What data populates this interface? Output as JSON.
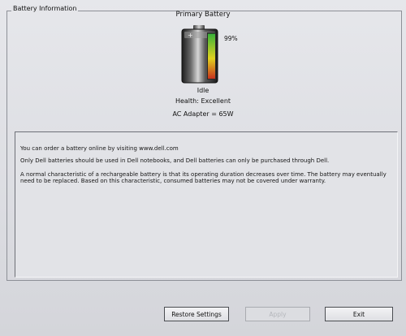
{
  "group": {
    "legend": "Battery Information"
  },
  "battery": {
    "title": "Primary Battery",
    "percent_label": "99%",
    "charge_level": 0.99,
    "status": "Idle",
    "health": "Health: Excellent",
    "adapter": "AC Adapter = 65W"
  },
  "info": {
    "line1": "You can order a battery online by visiting www.dell.com",
    "line2": "Only Dell batteries should be used in Dell notebooks, and Dell batteries can only be purchased through Dell.",
    "line3": "A normal characteristic of a rechargeable battery is that its operating duration decreases over time.  The battery may eventually need to be replaced.  Based on this characteristic, consumed batteries may not be covered under warranty."
  },
  "buttons": {
    "restore": "Restore Settings",
    "apply": "Apply",
    "exit": "Exit"
  },
  "colors": {
    "background": "#dcdee3",
    "charge_green": "#38b23a",
    "charge_yellow": "#e1d21f",
    "charge_red": "#c8321e"
  }
}
